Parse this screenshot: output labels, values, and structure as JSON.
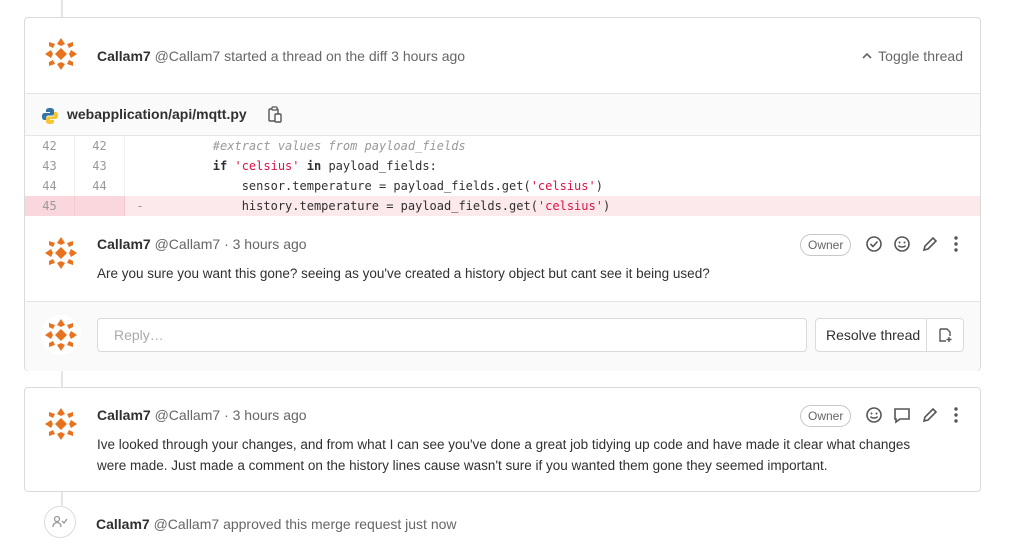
{
  "thread": {
    "author_name": "Callam7",
    "author_handle": "@Callam7",
    "action_text": "started a thread on the diff",
    "time": "3 hours ago",
    "toggle_label": "Toggle thread",
    "file": {
      "name": "webapplication/api/mqtt.py",
      "icon": "python-file-icon"
    },
    "diff_lines": [
      {
        "old": "42",
        "new": "42",
        "sign": "",
        "type": "context"
      },
      {
        "old": "43",
        "new": "43",
        "sign": "",
        "type": "context"
      },
      {
        "old": "44",
        "new": "44",
        "sign": "",
        "type": "context"
      },
      {
        "old": "45",
        "new": "",
        "sign": "-",
        "type": "removed"
      }
    ],
    "code": {
      "line1": "#extract values from payload_fields",
      "line2_kw": "if",
      "line2_str": "'celsius'",
      "line2_in": "in",
      "line2_rest": "payload_fields:",
      "line3_pre": "sensor.temperature = payload_fields.get(",
      "line3_str": "'celsius'",
      "line3_post": ")",
      "line4_pre": "history.temperature = payload_fields.get(",
      "line4_str": "'celsius'",
      "line4_post": ")"
    },
    "comment": {
      "author_name": "Callam7",
      "author_handle": "@Callam7",
      "time": "· 3 hours ago",
      "badge": "Owner",
      "text": "Are you sure you want this gone? seeing as you've created a history object but cant see it being used?"
    },
    "reply_placeholder": "Reply…",
    "resolve_label": "Resolve thread"
  },
  "note": {
    "author_name": "Callam7",
    "author_handle": "@Callam7",
    "time": "· 3 hours ago",
    "badge": "Owner",
    "text_line1": "Ive looked through your changes, and from what I can see you've done a great job tidying up code and have made it clear what changes",
    "text_line2": "were made. Just made a comment on the history lines cause wasn't sure if you wanted them gone they seemed important."
  },
  "system": {
    "author_name": "Callam7",
    "author_handle": "@Callam7",
    "text": "approved this merge request just now",
    "icon": "approval-icon"
  },
  "colors": {
    "avatar_orange": "#e8731f",
    "removed_bg": "#fbe9eb",
    "string": "#d14"
  }
}
